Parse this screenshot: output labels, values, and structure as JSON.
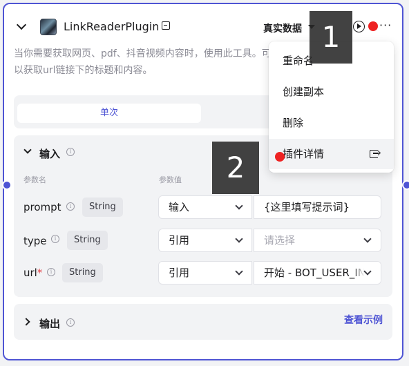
{
  "header": {
    "title": "LinkReaderPlugin",
    "data_mode": "真实数据"
  },
  "description": "当你需要获取网页、pdf、抖音视频内容时，使用此工具。可以获取url链接下的标题和内容。",
  "tabs": {
    "active": "单次"
  },
  "input_section": {
    "title": "输入",
    "col_name": "参数名",
    "col_value": "参数值",
    "params": [
      {
        "name": "prompt",
        "required": "",
        "type": "String",
        "mode": "输入",
        "value": "{这里填写提示词}",
        "is_placeholder": false
      },
      {
        "name": "type",
        "required": "",
        "type": "String",
        "mode": "引用",
        "value": "请选择",
        "is_placeholder": true
      },
      {
        "name": "url",
        "required": "*",
        "type": "String",
        "mode": "引用",
        "value": "开始 - BOT_USER_INPUT",
        "is_placeholder": false
      }
    ]
  },
  "output_section": {
    "title": "输出",
    "example_link": "查看示例"
  },
  "context_menu": {
    "items": [
      {
        "label": "重命名"
      },
      {
        "label": "创建副本"
      },
      {
        "label": "删除"
      },
      {
        "label": "插件详情"
      }
    ]
  },
  "annotations": {
    "marker_1": "1",
    "marker_2": "2",
    "dot_color": "#ee2222"
  },
  "colors": {
    "accent": "#4e54d4"
  }
}
